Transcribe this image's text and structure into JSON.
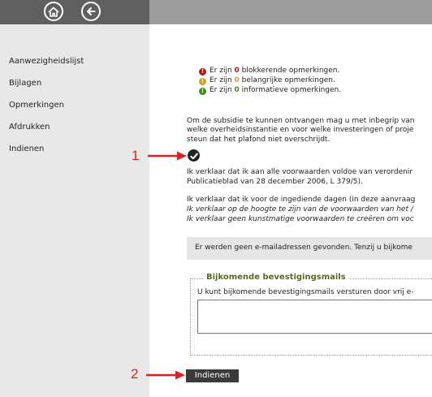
{
  "header": {
    "home_icon": "home-icon",
    "back_icon": "back-arrow-icon"
  },
  "sidebar": {
    "items": [
      {
        "label": "Aanwezigheidslijst"
      },
      {
        "label": "Bijlagen"
      },
      {
        "label": "Opmerkingen"
      },
      {
        "label": "Afdrukken"
      },
      {
        "label": "Indienen"
      }
    ]
  },
  "status": {
    "lines": [
      {
        "prefix": "Er zijn ",
        "count": "0",
        "suffix": " blokkerende opmerkingen.",
        "color": "#b01c1c"
      },
      {
        "prefix": "Er zijn ",
        "count": "0",
        "suffix": " belangrijke opmerkingen.",
        "color": "#c8a22a"
      },
      {
        "prefix": "Er zijn ",
        "count": "0",
        "suffix": " informatieve opmerkingen.",
        "color": "#3d8a1f"
      }
    ]
  },
  "intro": {
    "line1": "Om de subsidie te kunnen ontvangen mag u met inbegrip van",
    "line2": "welke overheidsinstantie en voor welke investeringen of proje",
    "line3": "steun dat het plafond niet overschrijdt."
  },
  "declaration": {
    "line1": "Ik verklaar dat ik aan alle voorwaarden voldoe van verordenir",
    "line2": "Publicatieblad van 28 december 2006, L 379/5).",
    "line3": "Ik verklaar dat ik voor de ingediende dagen (in deze aanvraag",
    "line4": "Ik verklaar op de hoogte te zijn van de voorwaarden van het /",
    "line5": "Ik verklaar geen kunstmatige voorwaarden te creëren om voc"
  },
  "email_notice": "Er werden geen e-mailadressen gevonden. Tenzij u bijkome",
  "extra_mails": {
    "legend": "Bijkomende bevestigingsmails",
    "description": "U kunt bijkomende bevestigingsmails versturen door vrij e-"
  },
  "submit_label": "Indienen",
  "annotations": {
    "marker1": "1",
    "marker2": "2",
    "color": "#e02020"
  }
}
